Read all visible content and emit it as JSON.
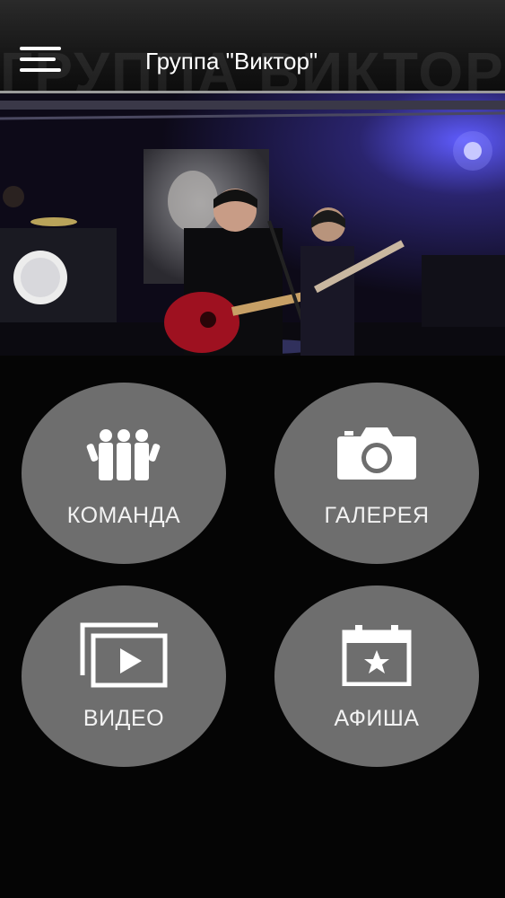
{
  "header": {
    "title": "Группа \"Виктор\"",
    "menu_icon": "hamburger-menu-icon",
    "background_text": "ГРУППА ВИКТОР"
  },
  "hero": {
    "image": "band-concert-photo"
  },
  "tiles": [
    {
      "label": "КОМАНДА",
      "icon": "team-people-icon"
    },
    {
      "label": "ГАЛЕРЕЯ",
      "icon": "camera-icon"
    },
    {
      "label": "ВИДЕО",
      "icon": "video-play-icon"
    },
    {
      "label": "АФИША",
      "icon": "calendar-star-icon"
    }
  ],
  "colors": {
    "background": "#050505",
    "tile": "#6e6e6e",
    "text": "#ffffff"
  }
}
